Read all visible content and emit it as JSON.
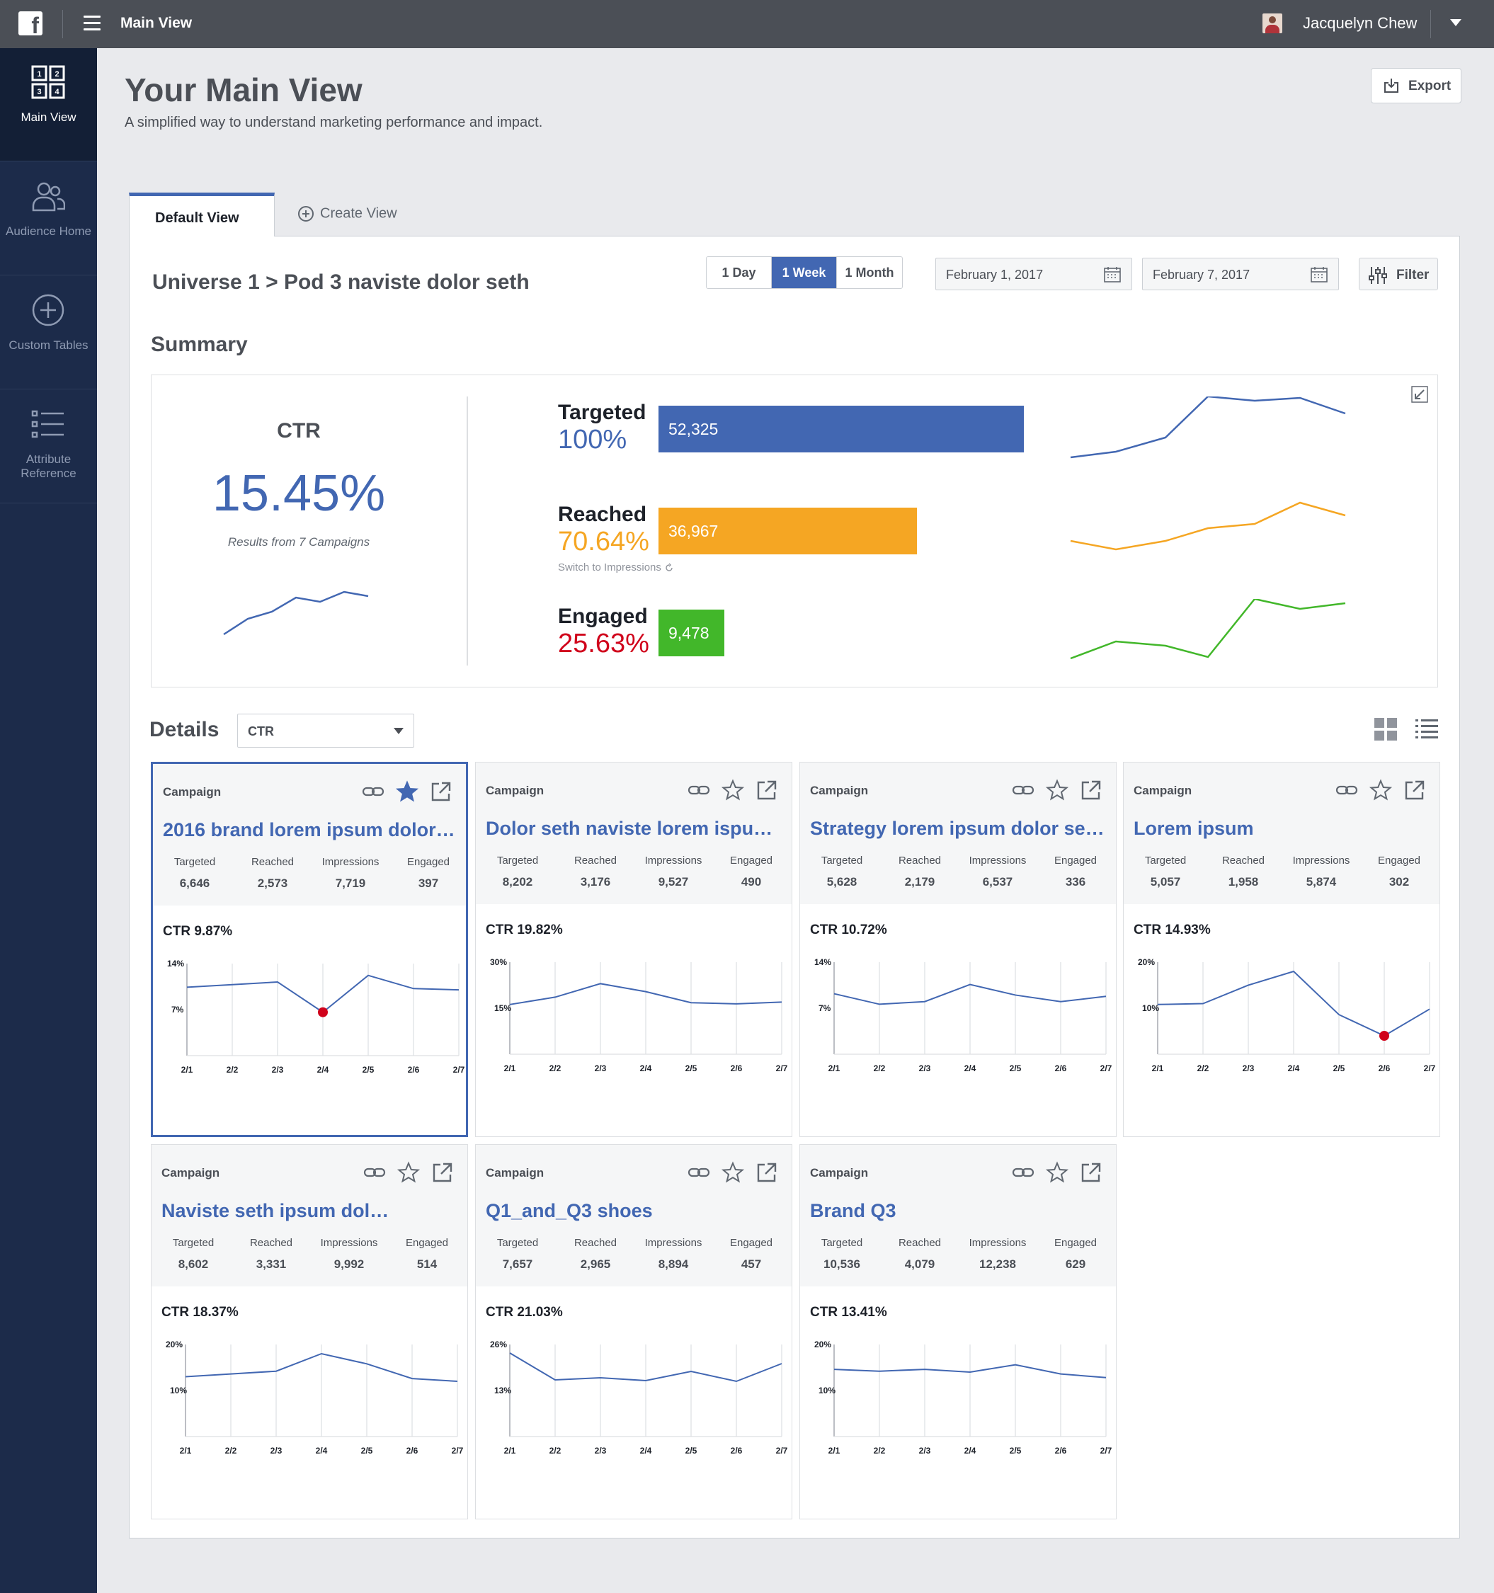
{
  "topbar": {
    "logo": "f",
    "title": "Main View",
    "user_name": "Jacquelyn Chew"
  },
  "sidebar": {
    "items": [
      {
        "label": "Main View",
        "icon": "grid-1234-icon",
        "active": true
      },
      {
        "label": "Audience Home",
        "icon": "people-icon",
        "active": false
      },
      {
        "label": "Custom Tables",
        "icon": "plus-circle-icon",
        "active": false
      },
      {
        "label": "Attribute Reference",
        "icon": "list-icon",
        "active": false
      }
    ]
  },
  "header": {
    "title": "Your Main View",
    "subtitle": "A simplified way to understand marketing performance and impact.",
    "export_label": "Export"
  },
  "tabs": {
    "active": "Default View",
    "create": "Create View"
  },
  "toolbar": {
    "breadcrumb": "Universe 1 > Pod 3 naviste dolor seth",
    "ranges": [
      "1 Day",
      "1 Week",
      "1 Month"
    ],
    "selected_range": "1 Week",
    "start_date": "February 1, 2017",
    "end_date": "February 7, 2017",
    "filter_label": "Filter"
  },
  "summary": {
    "title": "Summary",
    "ctr_label": "CTR",
    "ctr_value": "15.45%",
    "ctr_note": "Results from 7 Campaigns",
    "switch_note": "Switch to Impressions",
    "metrics": [
      {
        "name": "Targeted",
        "percent": "100%",
        "value": "52,325",
        "count": 52325,
        "color": "#4267b2"
      },
      {
        "name": "Reached",
        "percent": "70.64%",
        "value": "36,967",
        "count": 36967,
        "color": "#f5a623"
      },
      {
        "name": "Engaged",
        "percent": "25.63%",
        "value": "9,478",
        "count": 9478,
        "color": "#42b72a",
        "pct_color": "#d0021b"
      }
    ]
  },
  "details": {
    "title": "Details",
    "metric_select": "CTR",
    "cards": [
      {
        "caption": "Campaign",
        "title": "2016 brand lorem ipsum dolor…",
        "starred": true,
        "selected": true,
        "stats": {
          "Targeted": "6,646",
          "Reached": "2,573",
          "Impressions": "7,719",
          "Engaged": "397"
        },
        "ctr": "CTR 9.87%"
      },
      {
        "caption": "Campaign",
        "title": "Dolor seth naviste lorem ispu…",
        "starred": false,
        "selected": false,
        "stats": {
          "Targeted": "8,202",
          "Reached": "3,176",
          "Impressions": "9,527",
          "Engaged": "490"
        },
        "ctr": "CTR 19.82%"
      },
      {
        "caption": "Campaign",
        "title": "Strategy lorem ipsum dolor se…",
        "starred": false,
        "selected": false,
        "stats": {
          "Targeted": "5,628",
          "Reached": "2,179",
          "Impressions": "6,537",
          "Engaged": "336"
        },
        "ctr": "CTR 10.72%"
      },
      {
        "caption": "Campaign",
        "title": "Lorem ipsum",
        "starred": false,
        "selected": false,
        "stats": {
          "Targeted": "5,057",
          "Reached": "1,958",
          "Impressions": "5,874",
          "Engaged": "302"
        },
        "ctr": "CTR 14.93%"
      },
      {
        "caption": "Campaign",
        "title": "Naviste seth ipsum dol…",
        "starred": false,
        "selected": false,
        "stats": {
          "Targeted": "8,602",
          "Reached": "3,331",
          "Impressions": "9,992",
          "Engaged": "514"
        },
        "ctr": "CTR 18.37%"
      },
      {
        "caption": "Campaign",
        "title": "Q1_and_Q3 shoes",
        "starred": false,
        "selected": false,
        "stats": {
          "Targeted": "7,657",
          "Reached": "2,965",
          "Impressions": "8,894",
          "Engaged": "457"
        },
        "ctr": "CTR 21.03%"
      },
      {
        "caption": "Campaign",
        "title": "Brand Q3",
        "starred": false,
        "selected": false,
        "stats": {
          "Targeted": "10,536",
          "Reached": "4,079",
          "Impressions": "12,238",
          "Engaged": "629"
        },
        "ctr": "CTR 13.41%"
      }
    ]
  },
  "chart_data": [
    {
      "type": "line",
      "x": [
        "2/1",
        "2/2",
        "2/3",
        "2/4",
        "2/5",
        "2/6",
        "2/7"
      ],
      "ylim": [
        0,
        14
      ],
      "yticks": [
        "14%",
        "7%"
      ],
      "values": [
        10.4,
        10.8,
        11.2,
        6.6,
        12.2,
        10.2,
        10.0
      ],
      "highlight_index": 3
    },
    {
      "type": "line",
      "x": [
        "2/1",
        "2/2",
        "2/3",
        "2/4",
        "2/5",
        "2/6",
        "2/7"
      ],
      "ylim": [
        0,
        30
      ],
      "yticks": [
        "30%",
        "15%"
      ],
      "values": [
        16.2,
        18.6,
        23.0,
        20.4,
        16.8,
        16.4,
        17.0
      ]
    },
    {
      "type": "line",
      "x": [
        "2/1",
        "2/2",
        "2/3",
        "2/4",
        "2/5",
        "2/6",
        "2/7"
      ],
      "ylim": [
        0,
        14
      ],
      "yticks": [
        "14%",
        "7%"
      ],
      "values": [
        9.2,
        7.6,
        8.0,
        10.6,
        9.0,
        8.0,
        8.8
      ]
    },
    {
      "type": "line",
      "x": [
        "2/1",
        "2/2",
        "2/3",
        "2/4",
        "2/5",
        "2/6",
        "2/7"
      ],
      "ylim": [
        0,
        20
      ],
      "yticks": [
        "20%",
        "10%"
      ],
      "values": [
        10.8,
        11.0,
        15.0,
        18.0,
        8.6,
        4.0,
        9.8
      ],
      "highlight_index": 5
    },
    {
      "type": "line",
      "x": [
        "2/1",
        "2/2",
        "2/3",
        "2/4",
        "2/5",
        "2/6",
        "2/7"
      ],
      "ylim": [
        0,
        20
      ],
      "yticks": [
        "20%",
        "10%"
      ],
      "values": [
        13.0,
        13.6,
        14.2,
        18.0,
        15.8,
        12.6,
        12.0
      ]
    },
    {
      "type": "line",
      "x": [
        "2/1",
        "2/2",
        "2/3",
        "2/4",
        "2/5",
        "2/6",
        "2/7"
      ],
      "ylim": [
        0,
        26
      ],
      "yticks": [
        "26%",
        "13%"
      ],
      "values": [
        23.6,
        16.0,
        16.6,
        15.8,
        18.4,
        15.6,
        20.6
      ]
    },
    {
      "type": "line",
      "x": [
        "2/1",
        "2/2",
        "2/3",
        "2/4",
        "2/5",
        "2/6",
        "2/7"
      ],
      "ylim": [
        0,
        20
      ],
      "yticks": [
        "20%",
        "10%"
      ],
      "values": [
        14.6,
        14.2,
        14.6,
        14.0,
        15.6,
        13.6,
        12.8
      ]
    }
  ]
}
